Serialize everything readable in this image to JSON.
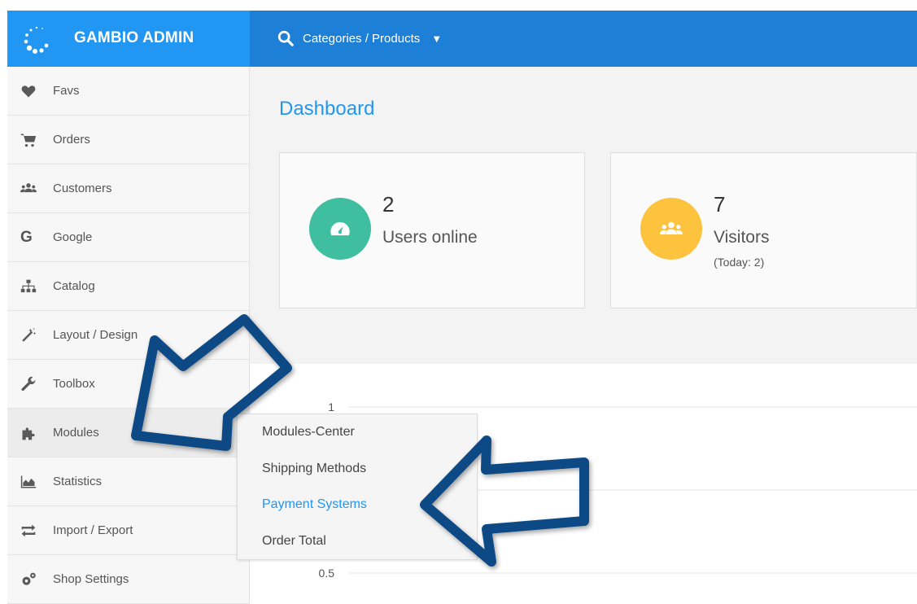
{
  "brand": {
    "title": "GAMBIO ADMIN"
  },
  "search": {
    "label": "Categories / Products"
  },
  "sidebar": {
    "items": [
      {
        "label": "Favs",
        "icon": "heart-icon"
      },
      {
        "label": "Orders",
        "icon": "cart-icon"
      },
      {
        "label": "Customers",
        "icon": "users-icon"
      },
      {
        "label": "Google",
        "icon": "google-icon"
      },
      {
        "label": "Catalog",
        "icon": "sitemap-icon"
      },
      {
        "label": "Layout / Design",
        "icon": "magic-wand-icon"
      },
      {
        "label": "Toolbox",
        "icon": "wrench-icon"
      },
      {
        "label": "Modules",
        "icon": "puzzle-icon"
      },
      {
        "label": "Statistics",
        "icon": "area-chart-icon"
      },
      {
        "label": "Import / Export",
        "icon": "exchange-icon"
      },
      {
        "label": "Shop Settings",
        "icon": "cogs-icon"
      }
    ]
  },
  "page": {
    "title": "Dashboard"
  },
  "stats": {
    "users": {
      "value": "2",
      "label": "Users online",
      "icon": "dashboard-icon",
      "color": "#3fbf9f"
    },
    "visitors": {
      "value": "7",
      "label": "Visitors",
      "sub": "(Today: 2)",
      "icon": "users-icon",
      "color": "#fdc23e"
    }
  },
  "flyout": {
    "items": [
      {
        "label": "Modules-Center"
      },
      {
        "label": "Shipping Methods"
      },
      {
        "label": "Payment Systems"
      },
      {
        "label": "Order Total"
      }
    ]
  },
  "chart_data": {
    "type": "line",
    "yticks": [
      "1",
      "0.5"
    ]
  },
  "colors": {
    "accent": "#2196f3",
    "topbar": "#1d7fd6",
    "arrow": "#0d4a85"
  }
}
